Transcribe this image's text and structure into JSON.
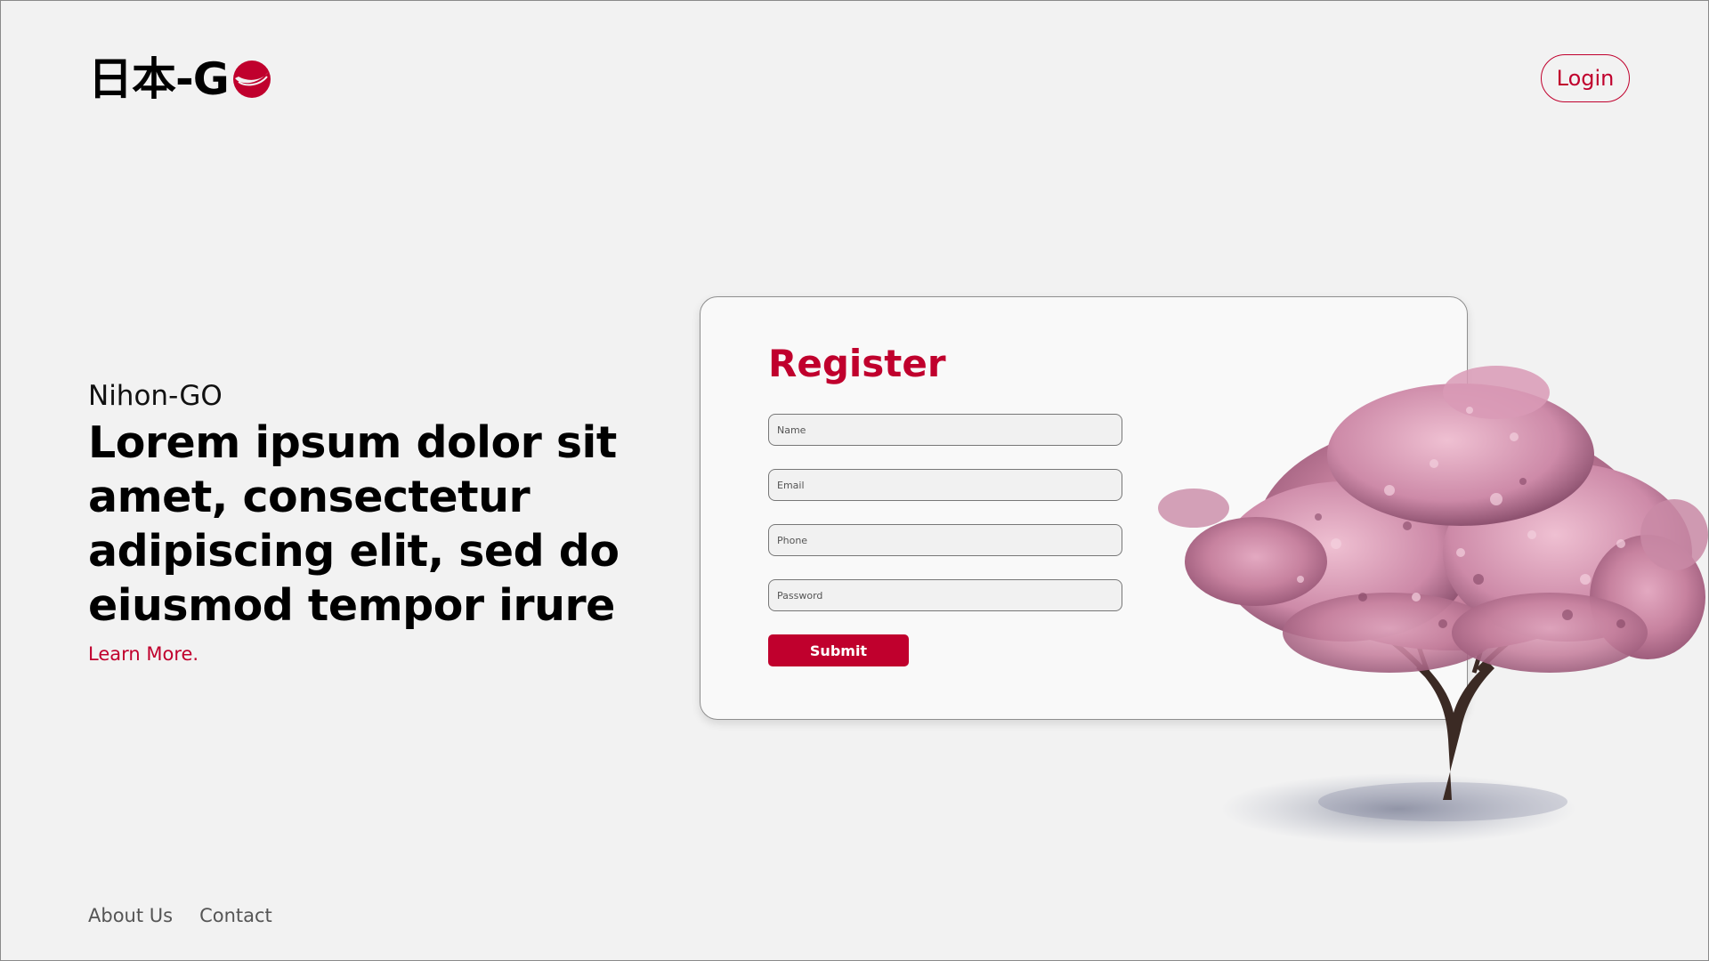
{
  "header": {
    "logo_text": "日本-G",
    "login_label": "Login"
  },
  "hero": {
    "eyebrow": "Nihon-GO",
    "headline": "Lorem ipsum dolor sit amet, consectetur adipiscing elit, sed do eiusmod tempor irure",
    "learn_more": "Learn More."
  },
  "register": {
    "title": "Register",
    "fields": {
      "name": {
        "placeholder": "Name",
        "value": ""
      },
      "email": {
        "placeholder": "Email",
        "value": ""
      },
      "phone": {
        "placeholder": "Phone",
        "value": ""
      },
      "password": {
        "placeholder": "Password",
        "value": ""
      }
    },
    "submit_label": "Submit"
  },
  "footer": {
    "links": [
      "About Us",
      "Contact"
    ]
  },
  "colors": {
    "brand_red": "#c0002d",
    "background": "#f2f2f2",
    "card_background": "#f9f9f9",
    "blossom_pink": "#c98aa6"
  },
  "icons": {
    "logo_mark": "red-sun-swoosh-icon",
    "illustration": "cherry-blossom-tree"
  }
}
